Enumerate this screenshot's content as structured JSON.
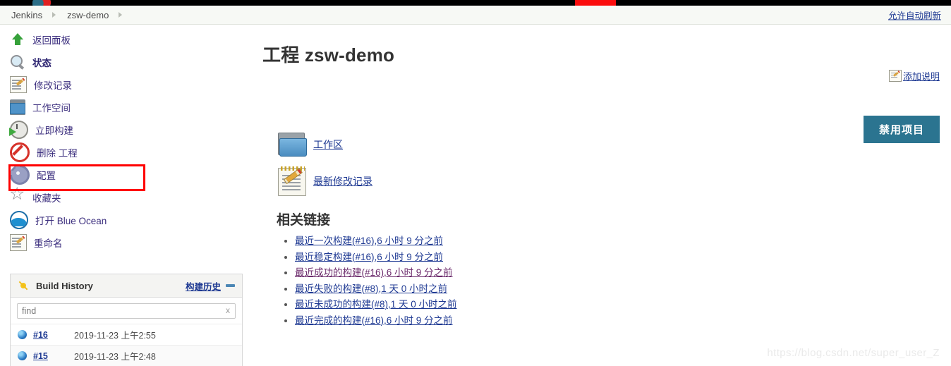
{
  "browser": {
    "favicon_name": "site-favicon",
    "redmark_name": "red-marker"
  },
  "breadcrumb": {
    "items": [
      {
        "label": "Jenkins"
      },
      {
        "label": "zsw-demo"
      }
    ],
    "auto_refresh_label": "允许自动刷新"
  },
  "sidebar": {
    "tasks": [
      {
        "label": "返回面板",
        "icon": "up-arrow-icon",
        "bold": false
      },
      {
        "label": "状态",
        "icon": "magnifier-icon",
        "bold": true
      },
      {
        "label": "修改记录",
        "icon": "notepad-pencil-icon",
        "bold": false
      },
      {
        "label": "工作空间",
        "icon": "folder-icon",
        "bold": false
      },
      {
        "label": "立即构建",
        "icon": "build-now-icon",
        "bold": false
      },
      {
        "label": "删除 工程",
        "icon": "no-entry-icon",
        "bold": false
      },
      {
        "label": "配置",
        "icon": "gear-icon",
        "bold": false
      },
      {
        "label": "收藏夹",
        "icon": "star-icon",
        "bold": false
      },
      {
        "label": "打开 Blue Ocean",
        "icon": "blue-ocean-icon",
        "bold": false
      },
      {
        "label": "重命名",
        "icon": "notepad-pencil-icon",
        "bold": false
      }
    ],
    "annotation": {
      "target_label": "配置",
      "color": "#ff0000"
    }
  },
  "build_history": {
    "title": "Build History",
    "trend_link": "构建历史",
    "collapse_icon": "collapse-icon",
    "find_placeholder": "find",
    "find_value": "",
    "clear_label": "x",
    "rows": [
      {
        "number": "#16",
        "date": "2019-11-23 上午2:55",
        "status": "blue"
      },
      {
        "number": "#15",
        "date": "2019-11-23 上午2:48",
        "status": "blue"
      }
    ]
  },
  "main": {
    "page_title": "工程 zsw-demo",
    "add_description_label": "添加说明",
    "disable_button_label": "禁用项目",
    "disable_button_color": "#2b7490",
    "shortcuts": [
      {
        "label": "工作区",
        "icon": "folder-icon"
      },
      {
        "label": "最新修改记录",
        "icon": "notepad-pencil-icon"
      }
    ],
    "related_links": {
      "title": "相关链接",
      "items": [
        {
          "label": "最近一次构建(#16),6 小时 9 分之前",
          "visited": false
        },
        {
          "label": "最近稳定构建(#16),6 小时 9 分之前",
          "visited": false
        },
        {
          "label": "最近成功的构建(#16),6 小时 9 分之前",
          "visited": true
        },
        {
          "label": "最近失败的构建(#8),1 天 0 小时之前",
          "visited": false
        },
        {
          "label": "最近未成功的构建(#8),1 天 0 小时之前",
          "visited": false
        },
        {
          "label": "最近完成的构建(#16),6 小时 9 分之前",
          "visited": false
        }
      ]
    }
  },
  "watermark": "https://blog.csdn.net/super_user_Z"
}
